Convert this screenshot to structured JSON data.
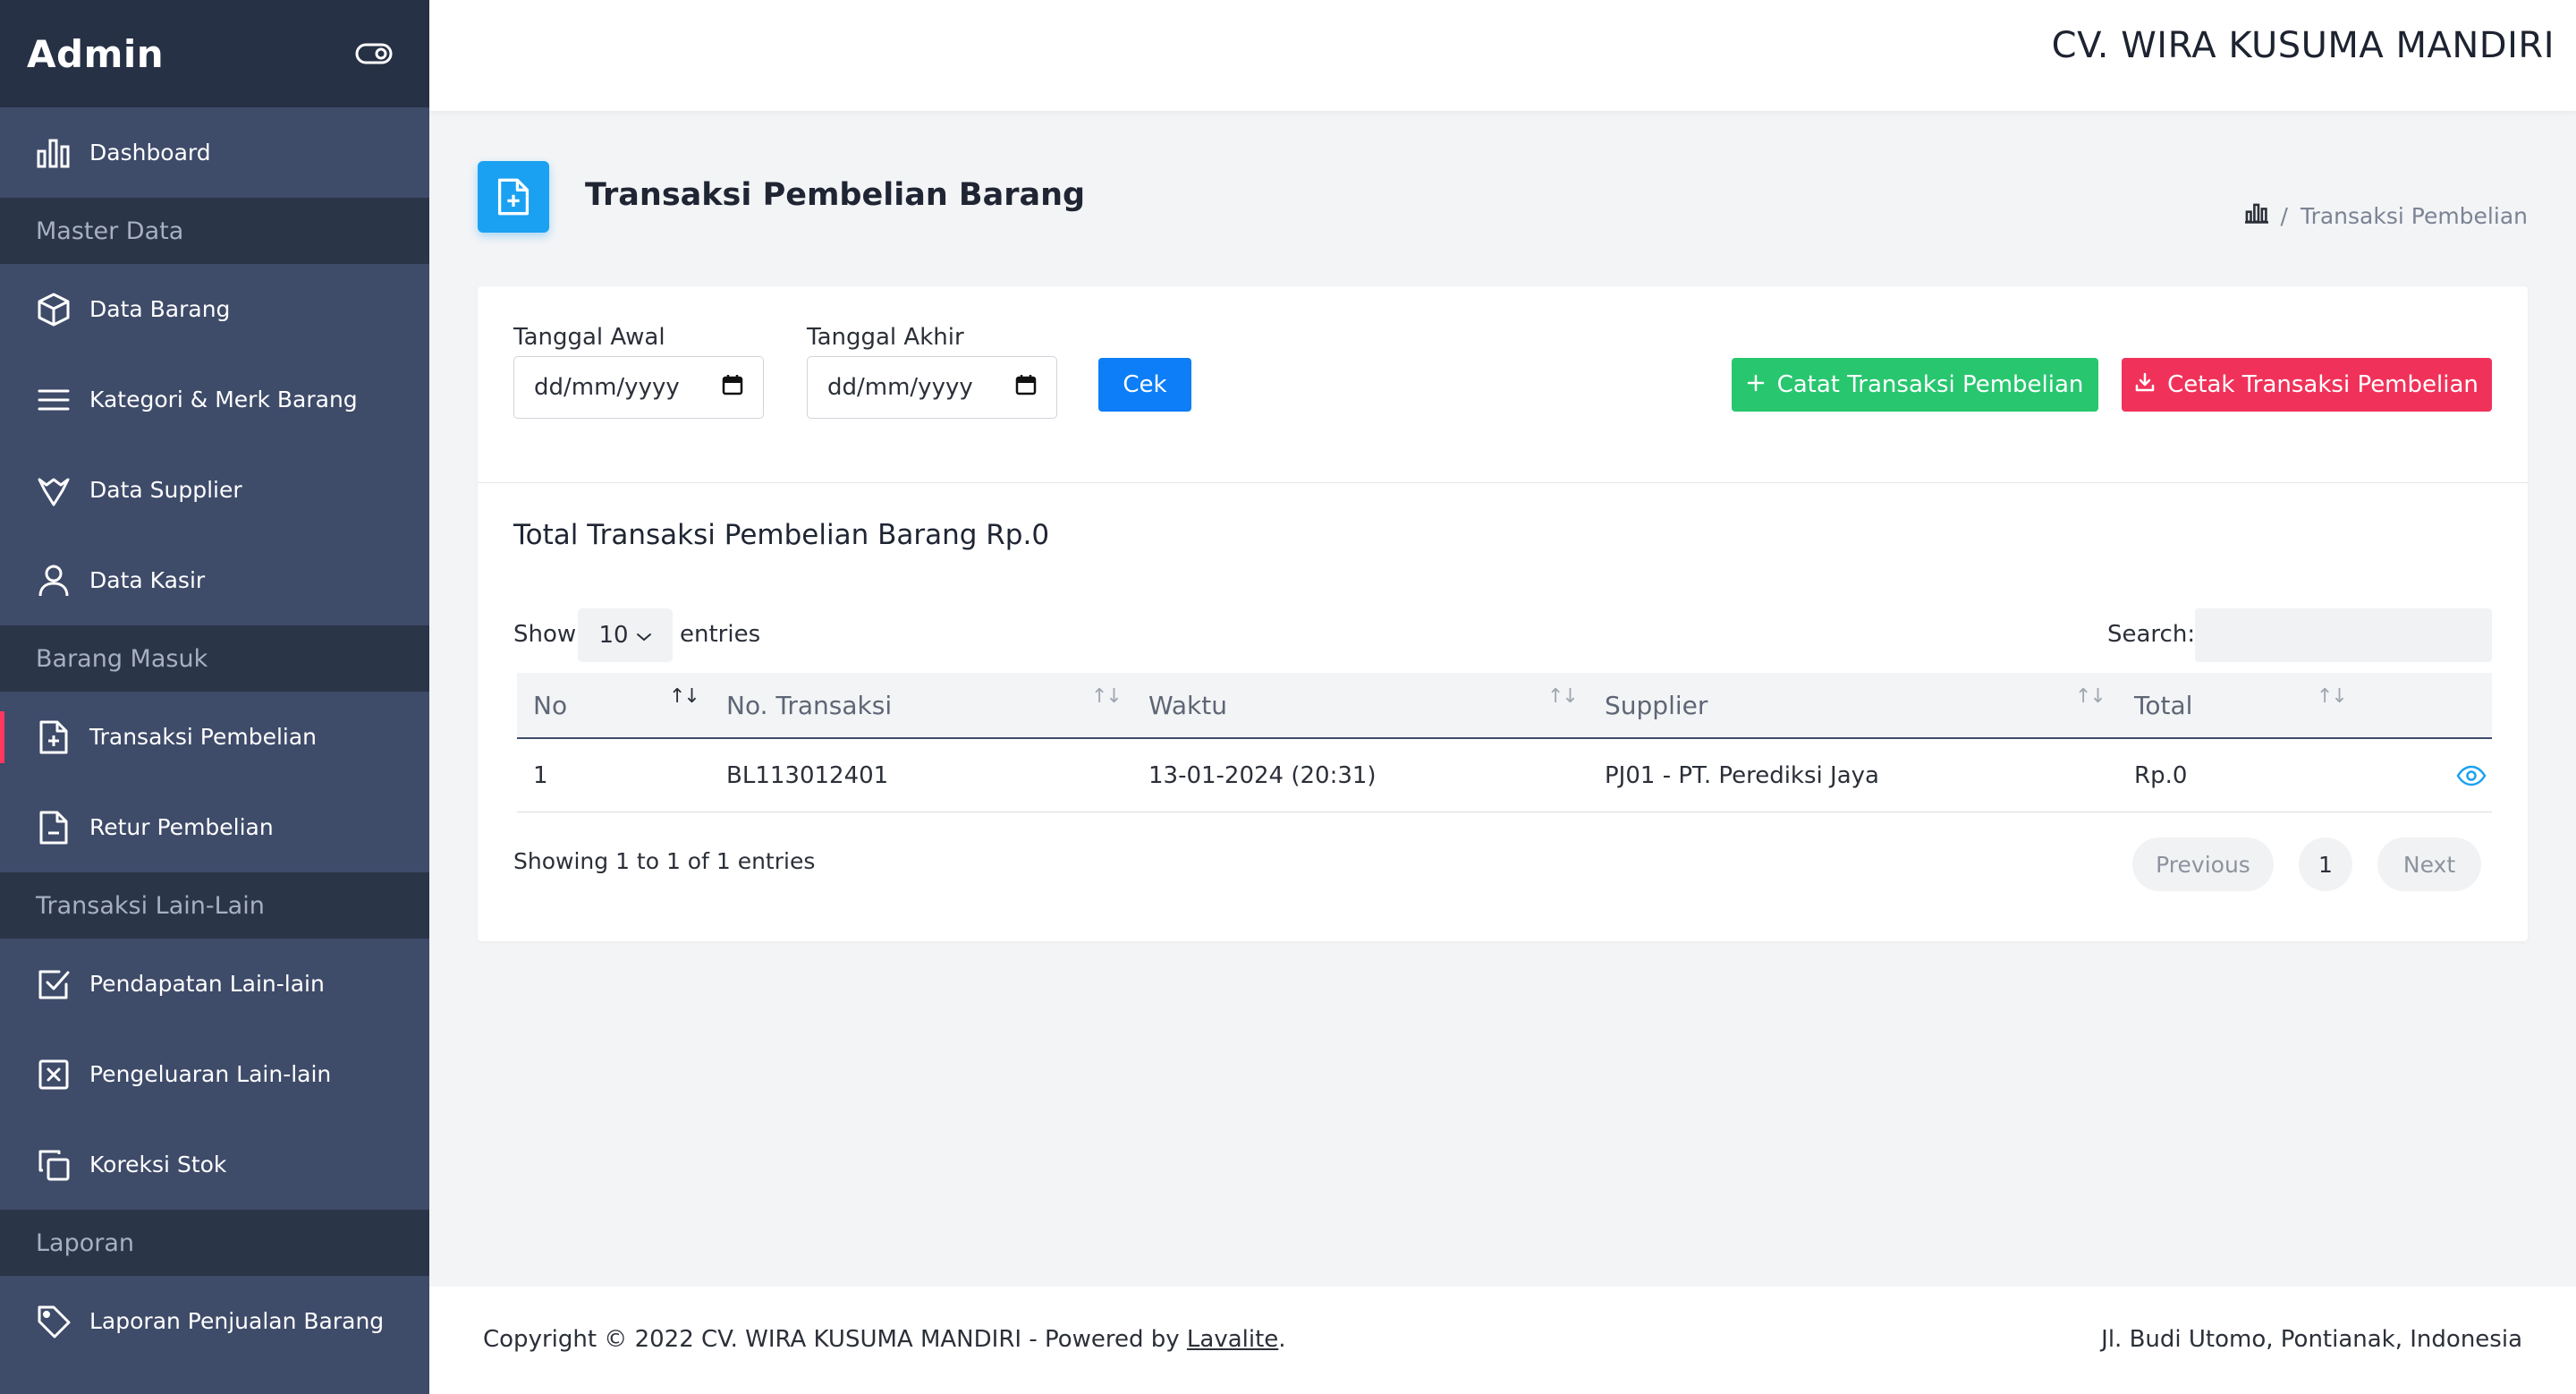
{
  "sidebar": {
    "brand": "Admin",
    "items": [
      {
        "type": "item",
        "label": "Dashboard",
        "icon": "bar-chart-icon"
      },
      {
        "type": "header",
        "label": "Master Data"
      },
      {
        "type": "item",
        "label": "Data Barang",
        "icon": "box-icon"
      },
      {
        "type": "item",
        "label": "Kategori & Merk Barang",
        "icon": "menu-lines-icon"
      },
      {
        "type": "item",
        "label": "Data Supplier",
        "icon": "supplier-icon"
      },
      {
        "type": "item",
        "label": "Data Kasir",
        "icon": "user-icon"
      },
      {
        "type": "header",
        "label": "Barang Masuk"
      },
      {
        "type": "item",
        "label": "Transaksi Pembelian",
        "icon": "file-plus-icon",
        "active": true
      },
      {
        "type": "item",
        "label": "Retur Pembelian",
        "icon": "file-minus-icon"
      },
      {
        "type": "header",
        "label": "Transaksi Lain-Lain"
      },
      {
        "type": "item",
        "label": "Pendapatan Lain-lain",
        "icon": "check-square-icon"
      },
      {
        "type": "item",
        "label": "Pengeluaran Lain-lain",
        "icon": "x-square-icon"
      },
      {
        "type": "item",
        "label": "Koreksi Stok",
        "icon": "copy-icon"
      },
      {
        "type": "header",
        "label": "Laporan"
      },
      {
        "type": "item",
        "label": "Laporan Penjualan Barang",
        "icon": "tag-icon"
      }
    ]
  },
  "header": {
    "company": "CV. WIRA KUSUMA MANDIRI"
  },
  "page": {
    "title": "Transaksi Pembelian Barang",
    "breadcrumb_sep": "/",
    "breadcrumb_current": "Transaksi Pembelian"
  },
  "filter": {
    "start_label": "Tanggal Awal",
    "start_value": "dd/mm/yyyy",
    "end_label": "Tanggal Akhir",
    "end_value": "dd/mm/yyyy",
    "check_label": "Cek",
    "add_label": "Catat Transaksi Pembelian",
    "print_label": "Cetak Transaksi Pembelian"
  },
  "summary": {
    "total_text": "Total Transaksi Pembelian Barang Rp.0"
  },
  "table_controls": {
    "show_label": "Show",
    "page_length": "10",
    "entries_label": "entries",
    "search_label": "Search:"
  },
  "table": {
    "columns": [
      "No",
      "No. Transaksi",
      "Waktu",
      "Supplier",
      "Total"
    ],
    "rows": [
      {
        "no": "1",
        "transaksi": "BL113012401",
        "waktu": "13-01-2024 (20:31)",
        "supplier": "PJ01 - PT. Perediksi Jaya",
        "total": "Rp.0"
      }
    ]
  },
  "pagination": {
    "info": "Showing 1 to 1 of 1 entries",
    "previous": "Previous",
    "current": "1",
    "next": "Next"
  },
  "footer": {
    "copyright_prefix": "Copyright © 2022 CV. WIRA KUSUMA MANDIRI - Powered by ",
    "link": "Lavalite",
    "suffix": ".",
    "address": "Jl. Budi Utomo, Pontianak, Indonesia"
  },
  "colors": {
    "sidebar": "#3e4b69",
    "sidebar_header": "#2b3548",
    "accent_blue": "#0d7ef7",
    "accent_green": "#28c66f",
    "accent_red": "#f0325a",
    "active_marker": "#ff3860",
    "eye_icon": "#1ba1f2"
  }
}
